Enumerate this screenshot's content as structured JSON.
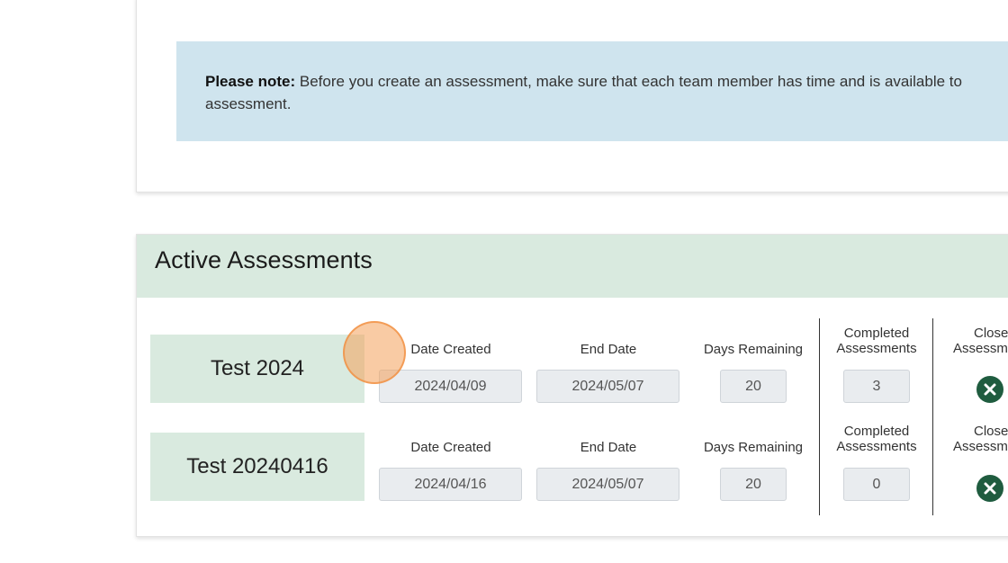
{
  "note": {
    "bold": "Please note:",
    "line1": " Before you create an assessment, make sure that each team member has time and is available to",
    "line2": "assessment."
  },
  "active": {
    "title": "Active Assessments",
    "columns": {
      "date_created": "Date Created",
      "end_date": "End Date",
      "days_remaining": "Days Remaining",
      "completed_line1": "Completed",
      "completed_line2": "Assessments",
      "close_line1": "Close",
      "close_line2": "Assessme"
    },
    "rows": [
      {
        "name": "Test 2024",
        "date_created": "2024/04/09",
        "end_date": "2024/05/07",
        "days_remaining": "20",
        "completed": "3"
      },
      {
        "name": "Test 20240416",
        "date_created": "2024/04/16",
        "end_date": "2024/05/07",
        "days_remaining": "20",
        "completed": "0"
      }
    ]
  },
  "colors": {
    "note_bg": "#cfe4ee",
    "header_bg": "#d9eadf",
    "close_icon": "#1f5c3f"
  }
}
